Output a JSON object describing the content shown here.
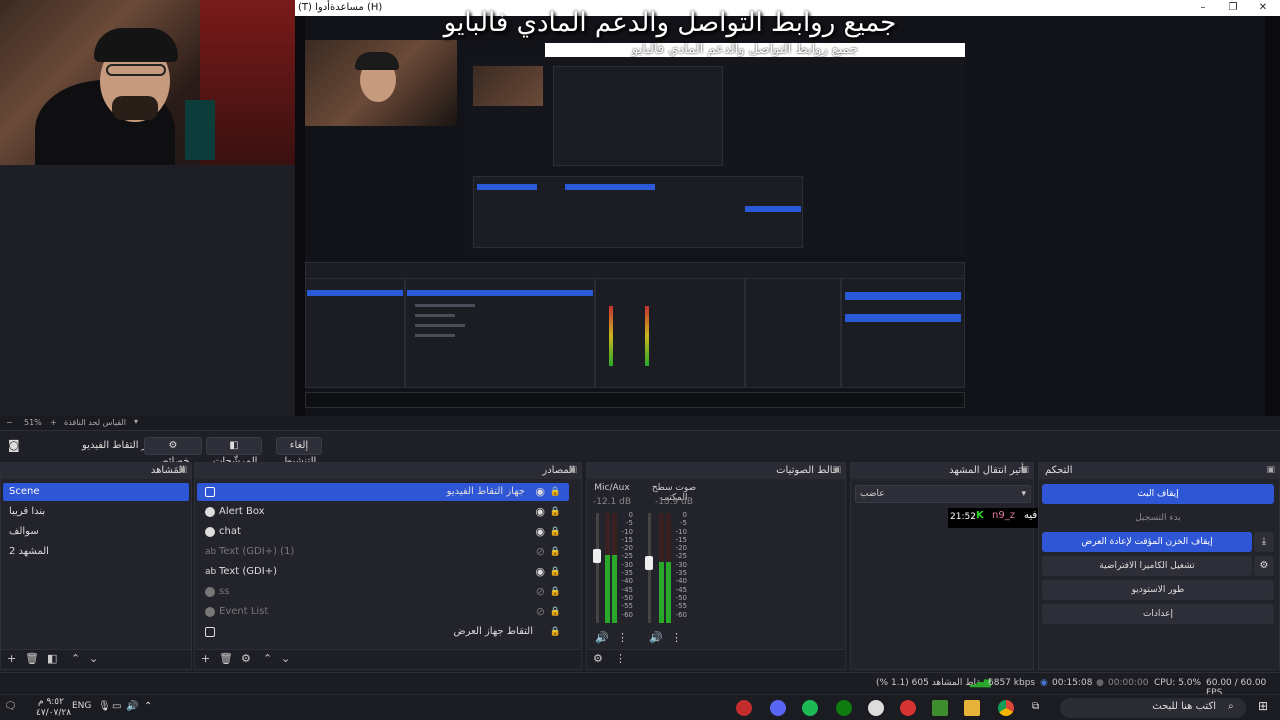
{
  "window": {
    "menu_help": "مساعدة (H)",
    "menu_tools": "(T) أدوا",
    "banner": "جميع روابط التواصل والدعم المادي فالبايو",
    "banner_small": "جميع روابط التواصل والدعم المادي فالبايو",
    "controls": [
      "–",
      "❐",
      "✕"
    ]
  },
  "zoom": {
    "value": "51%",
    "label": "القياس لحد النافذة"
  },
  "toolbar": {
    "source_label": "جهاز التقاط الفيديو",
    "properties": "خصائص",
    "filters": "المرشّحات",
    "deactivate": "إلغاء التنشيط"
  },
  "scenes": {
    "title": "المَشاهد",
    "items": [
      "Scene",
      "بندا قريبا",
      "سوالف",
      "المشهد 2"
    ],
    "selected": 0
  },
  "sources": {
    "title": "المصادر",
    "items": [
      {
        "label": "جهاز التقاط الفيديو",
        "icon": "camera-icon",
        "visible": true,
        "rtl": true
      },
      {
        "label": "Alert Box",
        "icon": "globe-icon",
        "visible": true,
        "rtl": false
      },
      {
        "label": "chat",
        "icon": "globe-icon",
        "visible": true,
        "rtl": false
      },
      {
        "label": "Text (GDI+) (1)",
        "icon": "text-icon",
        "visible": false,
        "rtl": false
      },
      {
        "label": "Text (GDI+)",
        "icon": "text-icon",
        "visible": true,
        "rtl": false
      },
      {
        "label": "ss",
        "icon": "globe-icon",
        "visible": false,
        "rtl": false
      },
      {
        "label": "Event List",
        "icon": "globe-icon",
        "visible": false,
        "rtl": false
      },
      {
        "label": "التقاط جهاز العرض",
        "icon": "monitor-icon",
        "visible": true,
        "rtl": true
      }
    ]
  },
  "mixer": {
    "title": "خالط الصوتيات",
    "channels": [
      {
        "name": "Mic/Aux",
        "db": "-12.1 dB",
        "level": 0.62
      },
      {
        "name": "صوت سطح المكتب",
        "db": "-15.9 dB",
        "level": 0.55
      }
    ],
    "scale": [
      "0",
      "-5",
      "-10",
      "-15",
      "-20",
      "-25",
      "-30",
      "-35",
      "-40",
      "-45",
      "-50",
      "-55",
      "-60"
    ]
  },
  "transition": {
    "title": "تأثير انتقال المشهد",
    "value": "عاضب"
  },
  "controls": {
    "title": "التحكم",
    "stop_stream": "إيقاف البث",
    "start_record": "بدء التسجيل",
    "stop_buffer": "إيقاف الخزن المؤقت لإعادة العرض",
    "virtual_cam": "تشغيل الكاميرا الافتراضية",
    "studio_mode": "طور الاستوديو",
    "settings": "إعدادات"
  },
  "chat_overlay": {
    "time": "21:52",
    "user": "n9_z",
    "msg": "عافيه :"
  },
  "status": {
    "dropped": "إسقاط المشاهد 605 (1.1 %)",
    "bitrate": "6857 kbps",
    "live_time": "00:15:08",
    "rec_time": "00:00:00",
    "cpu": "CPU: 5.0%",
    "fps": "60.00 / 60.00 FPS"
  },
  "taskbar": {
    "time": "٩:٥٢ م",
    "date": "٤٧/٠٧/٢٨",
    "lang": "ENG",
    "search_placeholder": "اكتب هنا للبحث"
  },
  "colors": {
    "accent": "#2f56d4",
    "panel": "#22232b",
    "bg": "#1e1f24"
  }
}
